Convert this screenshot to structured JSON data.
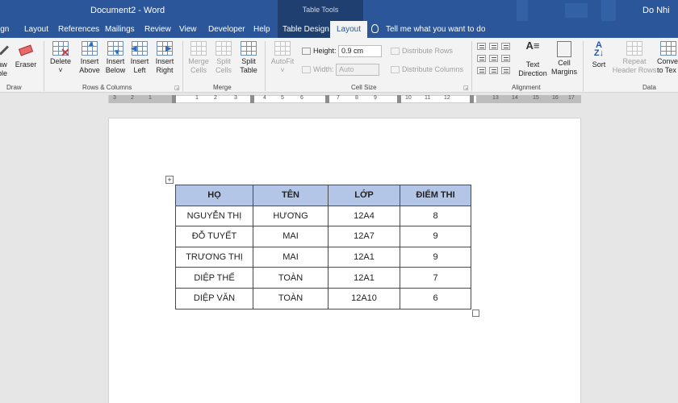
{
  "titlebar": {
    "doc_title": "Document2  -  Word",
    "context_label": "Table Tools",
    "user": "Do Nhi"
  },
  "tabs": [
    {
      "label": "ign"
    },
    {
      "label": "Layout"
    },
    {
      "label": "References"
    },
    {
      "label": "Mailings"
    },
    {
      "label": "Review"
    },
    {
      "label": "View"
    },
    {
      "label": "Developer"
    },
    {
      "label": "Help"
    },
    {
      "label": "Table Design"
    },
    {
      "label": "Layout"
    }
  ],
  "tellme": "Tell me what you want to do",
  "ribbon": {
    "draw": {
      "draw_table_line1": "aw",
      "draw_table_line2": "ble",
      "eraser": "Eraser",
      "group": "Draw"
    },
    "rows_columns": {
      "delete": "Delete",
      "delete_caret": "˅",
      "insert_above_1": "Insert",
      "insert_above_2": "Above",
      "insert_below_1": "Insert",
      "insert_below_2": "Below",
      "insert_left_1": "Insert",
      "insert_left_2": "Left",
      "insert_right_1": "Insert",
      "insert_right_2": "Right",
      "group": "Rows & Columns"
    },
    "merge": {
      "merge_cells_1": "Merge",
      "merge_cells_2": "Cells",
      "split_cells_1": "Split",
      "split_cells_2": "Cells",
      "split_table_1": "Split",
      "split_table_2": "Table",
      "group": "Merge"
    },
    "cell_size": {
      "autofit": "AutoFit",
      "autofit_caret": "˅",
      "height_label": "Height:",
      "height_value": "0.9 cm",
      "width_label": "Width:",
      "width_value": "Auto",
      "distribute_rows": "Distribute Rows",
      "distribute_columns": "Distribute Columns",
      "group": "Cell Size"
    },
    "alignment": {
      "text_direction_1": "Text",
      "text_direction_2": "Direction",
      "cell_margins_1": "Cell",
      "cell_margins_2": "Margins",
      "group": "Alignment"
    },
    "data": {
      "sort": "Sort",
      "repeat_1": "Repeat",
      "repeat_2": "Header Rows",
      "convert_1": "Conve",
      "convert_2": "to Tex",
      "group": "Data"
    }
  },
  "ruler": {
    "labels": [
      "3",
      "2",
      "1",
      "1",
      "2",
      "3",
      "4",
      "5",
      "6",
      "7",
      "8",
      "9",
      "10",
      "11",
      "12",
      "13",
      "14",
      "15",
      "16",
      "17"
    ]
  },
  "table": {
    "headers": [
      "HỌ",
      "TÊN",
      "LỚP",
      "ĐIỂM THI"
    ],
    "rows": [
      [
        "NGUYỄN THỊ",
        "HƯƠNG",
        "12A4",
        "8"
      ],
      [
        "ĐỖ TUYẾT",
        "MAI",
        "12A7",
        "9"
      ],
      [
        "TRƯƠNG THỊ",
        "MAI",
        "12A1",
        "9"
      ],
      [
        "DIỆP THẾ",
        "TOÀN",
        "12A1",
        "7"
      ],
      [
        "DIỆP VĂN",
        "TOÀN",
        "12A10",
        "6"
      ]
    ]
  },
  "icons": {
    "move_handle": "move-icon",
    "resize_handle": "resize-icon",
    "tellme": "lightbulb-icon"
  }
}
